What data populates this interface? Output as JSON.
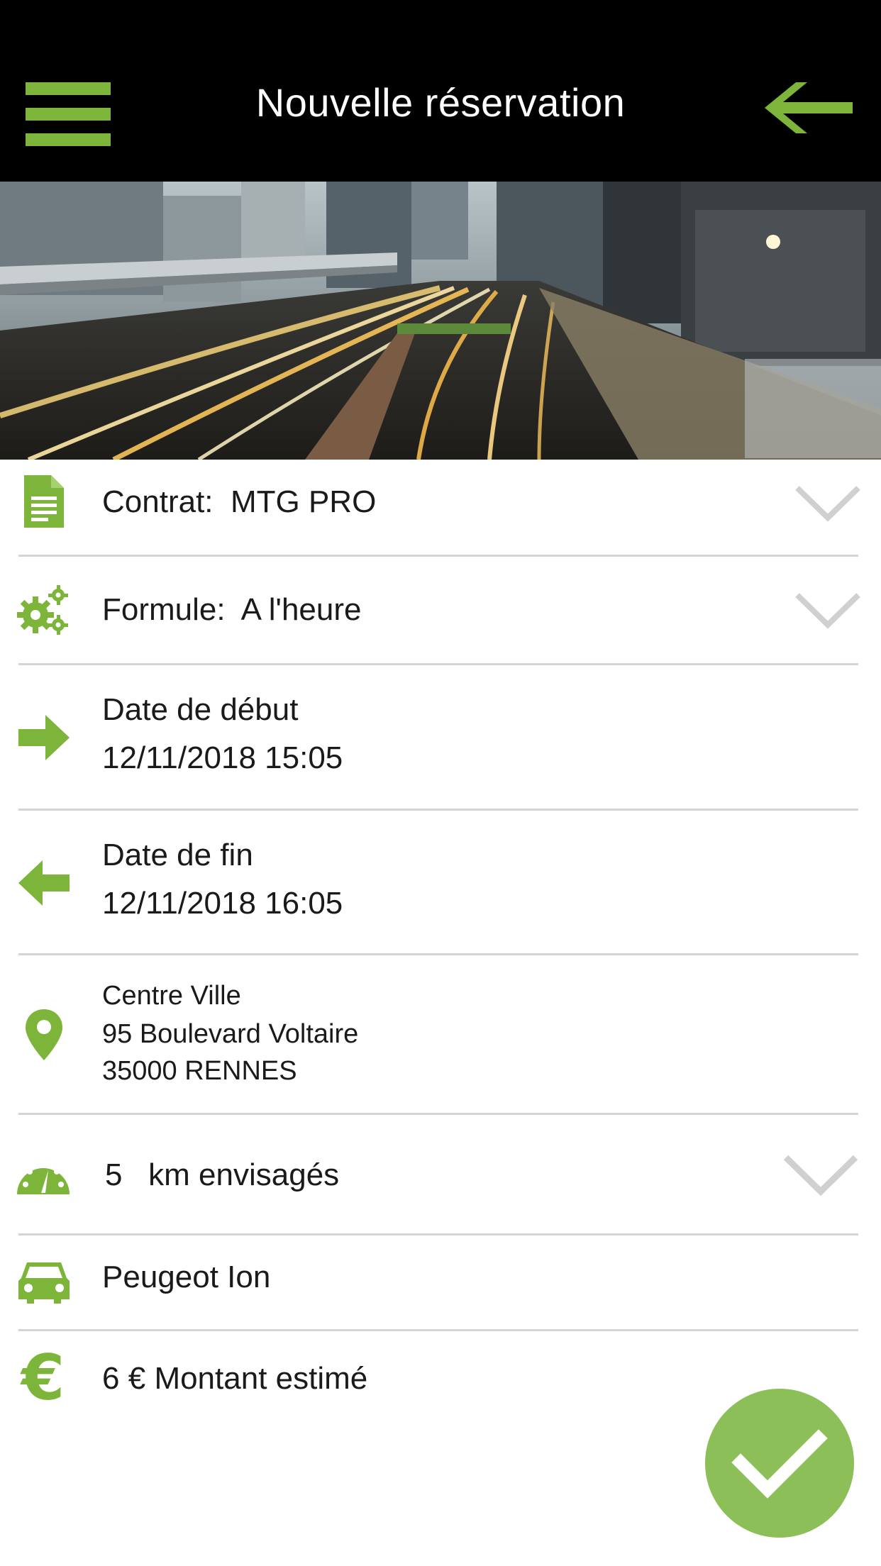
{
  "header": {
    "title": "Nouvelle réservation",
    "menu_icon": "hamburger-menu-icon",
    "back_icon": "arrow-left-icon"
  },
  "hero": {
    "description_icon": "city-traffic-photo"
  },
  "contract": {
    "label": "Contrat:",
    "value": "MTG PRO"
  },
  "formula": {
    "label": "Formule:",
    "value": "A l'heure"
  },
  "start": {
    "label": "Date de début",
    "value": "12/11/2018 15:05"
  },
  "end": {
    "label": "Date de fin",
    "value": "12/11/2018 16:05"
  },
  "location": {
    "line1": "Centre Ville",
    "line2": "95 Boulevard Voltaire",
    "line3": "35000 RENNES"
  },
  "distance": {
    "value": "5",
    "label": "km envisagés"
  },
  "vehicle": {
    "name": "Peugeot Ion"
  },
  "amount": {
    "value": "6",
    "currency": "€",
    "label": "Montant estimé"
  },
  "colors": {
    "accent": "#7cb53a",
    "fab": "#8cbf57",
    "header_bg": "#000000",
    "divider": "#d4d4d4",
    "chevron": "#d0d0d0"
  }
}
